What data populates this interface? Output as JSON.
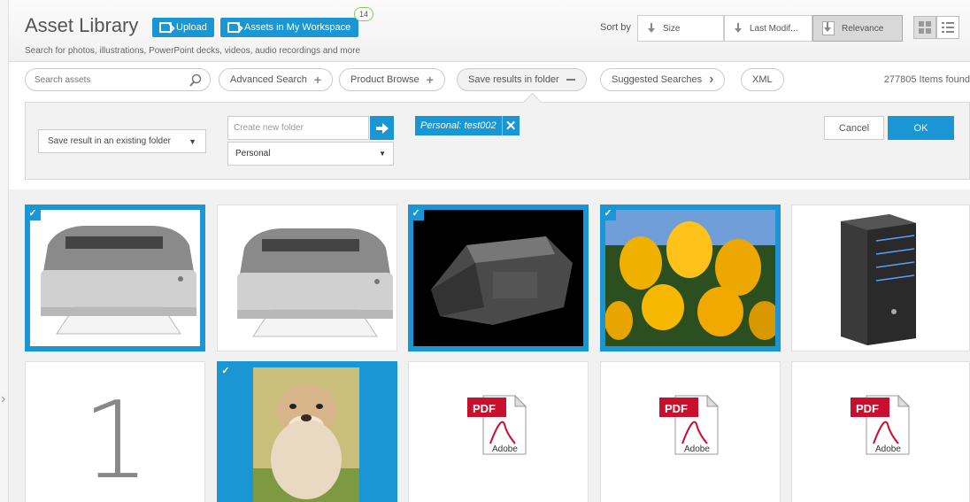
{
  "header": {
    "title": "Asset Library",
    "upload_label": "Upload",
    "workspace_label": "Assets in My Workspace",
    "workspace_count": "14",
    "subtitle": "Search for photos, illustrations, PowerPoint decks, videos, audio recordings and more"
  },
  "sort": {
    "label": "Sort by",
    "options": [
      "Size",
      "Last Modif...",
      "Relevance"
    ],
    "active": "Relevance"
  },
  "search": {
    "placeholder": "Search assets",
    "pills": [
      {
        "label": "Advanced Search",
        "icon": "plus-icon"
      },
      {
        "label": "Product Browse",
        "icon": "plus-icon"
      },
      {
        "label": "Save results in folder",
        "icon": "minus-icon"
      },
      {
        "label": "Suggested Searches",
        "icon": "chevron-right-icon"
      },
      {
        "label": "XML",
        "icon": ""
      }
    ],
    "count": "277805 Items found"
  },
  "folder_panel": {
    "existing_label": "Save result in an existing folder",
    "new_folder_placeholder": "Create new folder",
    "folder_type": "Personal",
    "tag": "Personal: test002",
    "cancel": "Cancel",
    "ok": "OK"
  },
  "assets": [
    {
      "type": "printer-image",
      "selected": true
    },
    {
      "type": "printer-image",
      "selected": false
    },
    {
      "type": "printer-cartridge-image",
      "selected": true
    },
    {
      "type": "tulips-image",
      "selected": true
    },
    {
      "type": "server-tower-image",
      "selected": false
    },
    {
      "type": "number-image",
      "selected": false,
      "text": "1"
    },
    {
      "type": "bulldog-image",
      "selected": true
    },
    {
      "type": "pdf-icon",
      "selected": false,
      "text": "PDF",
      "brand": "Adobe"
    },
    {
      "type": "pdf-icon",
      "selected": false,
      "text": "PDF",
      "brand": "Adobe"
    },
    {
      "type": "pdf-icon",
      "selected": false,
      "text": "PDF",
      "brand": "Adobe"
    }
  ],
  "colors": {
    "accent": "#1a96d4",
    "panel": "#f2f2f2"
  }
}
